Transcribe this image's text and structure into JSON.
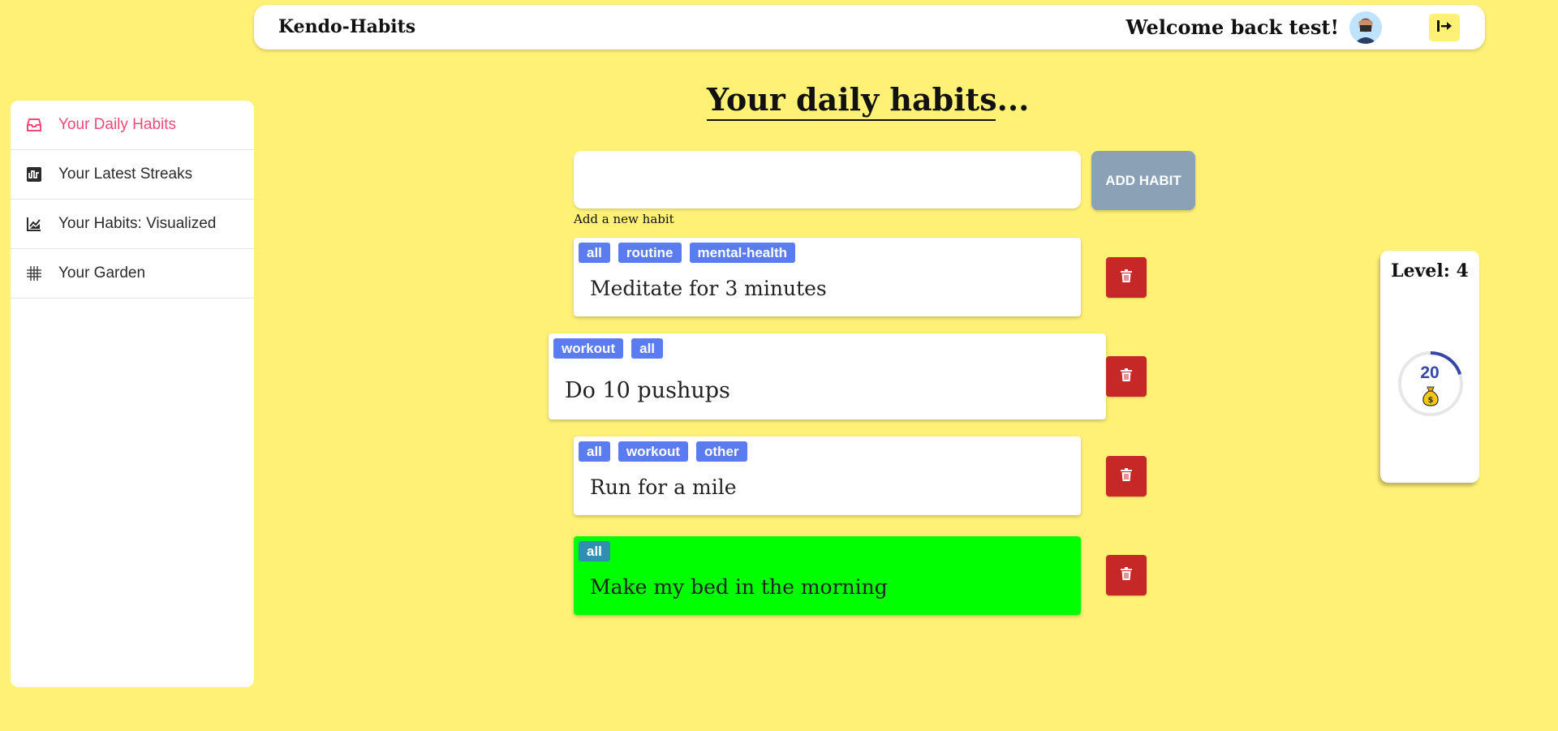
{
  "header": {
    "brand": "Kendo-Habits",
    "welcome": "Welcome back test!"
  },
  "sidebar": {
    "items": [
      {
        "label": "Your Daily Habits",
        "icon": "inbox-icon",
        "active": true
      },
      {
        "label": "Your Latest Streaks",
        "icon": "streak-icon",
        "active": false
      },
      {
        "label": "Your Habits: Visualized",
        "icon": "chart-line-icon",
        "active": false
      },
      {
        "label": "Your Garden",
        "icon": "grid-icon",
        "active": false
      }
    ]
  },
  "main": {
    "title": "Your daily habits...",
    "input": {
      "value": "",
      "help": "Add a new habit"
    },
    "add_button": "ADD HABIT",
    "habits": [
      {
        "tags": [
          "all",
          "routine",
          "mental-health"
        ],
        "text": "Meditate for 3 minutes",
        "done": false
      },
      {
        "tags": [
          "workout",
          "all"
        ],
        "text": "Do 10 pushups",
        "done": false
      },
      {
        "tags": [
          "all",
          "workout",
          "other"
        ],
        "text": "Run for a mile",
        "done": false
      },
      {
        "tags": [
          "all"
        ],
        "text": "Make my bed in the morning",
        "done": true
      }
    ]
  },
  "level": {
    "label": "Level: 4",
    "coins": "20",
    "progress": 0.2
  },
  "colors": {
    "background": "#fff176",
    "accent": "#ef4a78",
    "tag": "#5b7cf0",
    "done": "#00ff00",
    "delete": "#c62828"
  }
}
